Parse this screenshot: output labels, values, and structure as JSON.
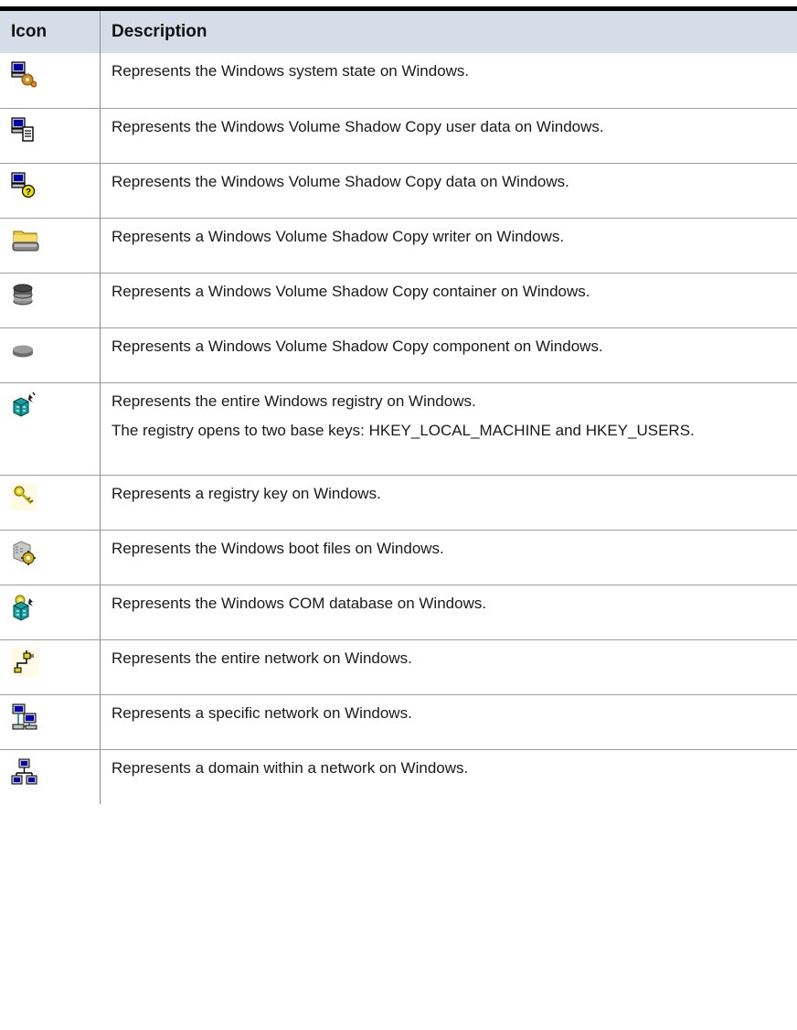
{
  "table": {
    "headers": {
      "icon": "Icon",
      "description": "Description"
    },
    "rows": [
      {
        "icon": "computer-gear-icon",
        "lines": [
          "Represents the Windows system state on Windows."
        ]
      },
      {
        "icon": "computer-document-icon",
        "lines": [
          "Represents the Windows Volume Shadow Copy user data on Windows."
        ]
      },
      {
        "icon": "computer-question-icon",
        "lines": [
          "Represents the Windows Volume Shadow Copy data on Windows."
        ]
      },
      {
        "icon": "folder-drive-icon",
        "lines": [
          "Represents a Windows Volume Shadow Copy writer on Windows."
        ]
      },
      {
        "icon": "database-stack-icon",
        "lines": [
          "Represents a Windows Volume Shadow Copy container on Windows."
        ]
      },
      {
        "icon": "disk-icon",
        "lines": [
          "Represents a Windows Volume Shadow Copy component on Windows."
        ]
      },
      {
        "icon": "registry-cubes-icon",
        "lines": [
          "Represents the entire Windows registry on Windows.",
          "The registry opens to two base keys: HKEY_LOCAL_MACHINE and HKEY_USERS."
        ]
      },
      {
        "icon": "key-icon",
        "lines": [
          "Represents a registry key on Windows."
        ]
      },
      {
        "icon": "boot-files-gear-icon",
        "lines": [
          "Represents the Windows boot files on Windows."
        ]
      },
      {
        "icon": "com-database-icon",
        "lines": [
          "Represents the Windows COM database on Windows."
        ]
      },
      {
        "icon": "network-plug-icon",
        "lines": [
          "Represents the entire network on Windows."
        ]
      },
      {
        "icon": "network-computers-icon",
        "lines": [
          "Represents a specific network on Windows."
        ]
      },
      {
        "icon": "domain-network-icon",
        "lines": [
          "Represents a domain within a network on Windows."
        ]
      }
    ]
  }
}
